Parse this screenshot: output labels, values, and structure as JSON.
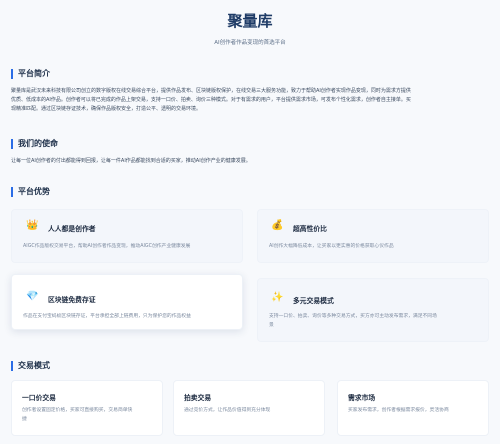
{
  "hero": {
    "title": "聚量库",
    "subtitle": "AI创作者作品变现的首选平台"
  },
  "intro": {
    "heading": "平台简介",
    "line1": "聚量库是武汉未来科技有限公司创立的数字版权在线交易综合平台，提供作品发布、区块链版权保护，在线交易三大服务功能，致力于帮助AI创作者实现作品变现，同时为需求方提供",
    "line2": "优质、低成本的AI作品。创作者可以将已完成的作品上架交易，支持一口价、拍卖、询价三种模式。对于有需求的用户，平台提供需求市场，可发布个性化需求，创作者自主接单。买",
    "line3": "现精准匹配。通过区块链存证技术，确保作品版权安全，打造公平、透明的交易环境。"
  },
  "mission": {
    "heading": "我们的使命",
    "text": "让每一位AI创作者的付出都能得到回报，让每一件AI作品都能找到合适的买家，推动AI创作产业的健康发展。"
  },
  "advantages": {
    "heading": "平台优势",
    "items": [
      {
        "icon": "crown-icon",
        "glyph": "👑",
        "title": "人人都是创作者",
        "desc": "AIGC作品版权交易平台，帮助AI创作者作品变现，推动AIGC创作产业健康发展"
      },
      {
        "icon": "money-bag-icon",
        "glyph": "💰",
        "title": "超高性价比",
        "desc": "AI创作大幅降低成本，让买家以更实惠的价格获取心仪作品"
      },
      {
        "icon": "diamond-icon",
        "glyph": "💎",
        "title": "区块链免费存证",
        "desc": "作品在支付宝蚂蚁区块链存证，平台承担全部上链费用，只为保护您的作品权益"
      },
      {
        "icon": "sparkles-icon",
        "glyph": "✨",
        "title": "多元交易模式",
        "desc_line1": "支持一口价、拍卖、询价等多种交易方式，买方亦可主动发布需求，满足不同场",
        "desc_line2": "景"
      }
    ]
  },
  "trade": {
    "heading": "交易模式",
    "items": [
      {
        "title": "一口价交易",
        "desc_line1": "创作者设置固定价格，买家可直接购买，交易简单快",
        "desc_line2": "捷"
      },
      {
        "title": "拍卖交易",
        "desc_line1": "通过竞价方式，让作品价值得到充分体现"
      },
      {
        "title": "需求市场",
        "desc_line1": "买家发布需求，创作者根据需求报价，灵活协商"
      }
    ]
  },
  "colors": {
    "accent": "#2b6de6",
    "title": "#1e3b66",
    "background": "#f7f9fc"
  }
}
